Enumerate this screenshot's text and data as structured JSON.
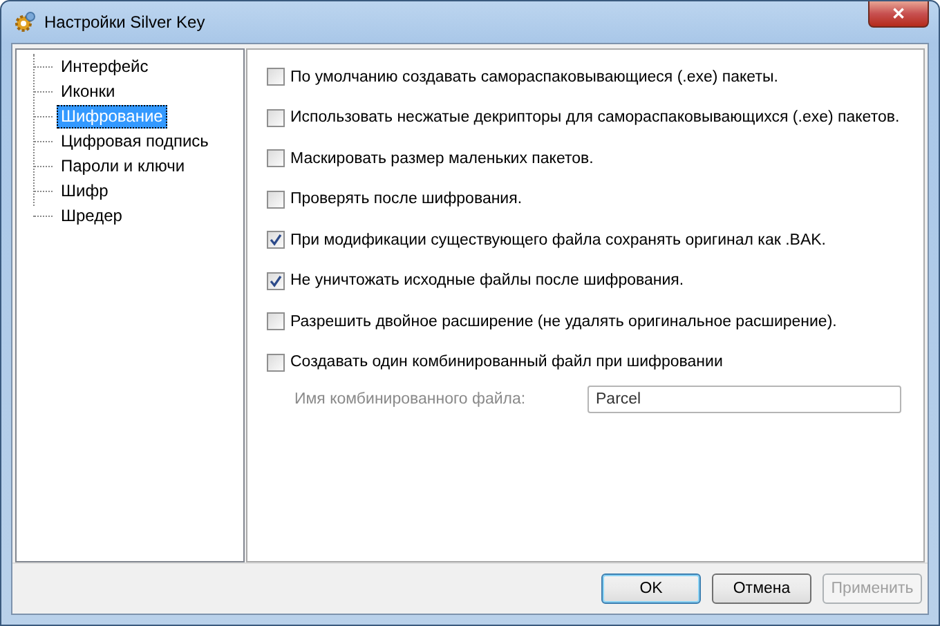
{
  "window": {
    "title": "Настройки Silver Key",
    "close": "✕"
  },
  "sidebar": {
    "items": [
      {
        "label": "Интерфейс",
        "selected": false
      },
      {
        "label": "Иконки",
        "selected": false
      },
      {
        "label": "Шифрование",
        "selected": true
      },
      {
        "label": "Цифровая подпись",
        "selected": false
      },
      {
        "label": "Пароли и ключи",
        "selected": false
      },
      {
        "label": "Шифр",
        "selected": false
      },
      {
        "label": "Шредер",
        "selected": false
      }
    ]
  },
  "options": [
    {
      "label": "По умолчанию создавать самораспаковывающиеся (.exe) пакеты.",
      "checked": false
    },
    {
      "label": "Использовать несжатые декрипторы для самораспаковывающихся (.exe) пакетов.",
      "checked": false
    },
    {
      "label": "Маскировать размер маленьких пакетов.",
      "checked": false
    },
    {
      "label": "Проверять после шифрования.",
      "checked": false
    },
    {
      "label": "При модификации существующего файла сохранять оригинал как .BAK.",
      "checked": true
    },
    {
      "label": "Не уничтожать исходные файлы после шифрования.",
      "checked": true
    },
    {
      "label": "Разрешить двойное расширение (не удалять оригинальное расширение).",
      "checked": false
    },
    {
      "label": "Создавать один комбинированный файл при шифровании",
      "checked": false
    }
  ],
  "combined_file": {
    "label": "Имя комбинированного файла:",
    "value": "Parcel",
    "disabled": true
  },
  "buttons": [
    {
      "label": "OK",
      "default": true,
      "disabled": false
    },
    {
      "label": "Отмена",
      "default": false,
      "disabled": false
    },
    {
      "label": "Применить",
      "default": false,
      "disabled": true
    }
  ]
}
